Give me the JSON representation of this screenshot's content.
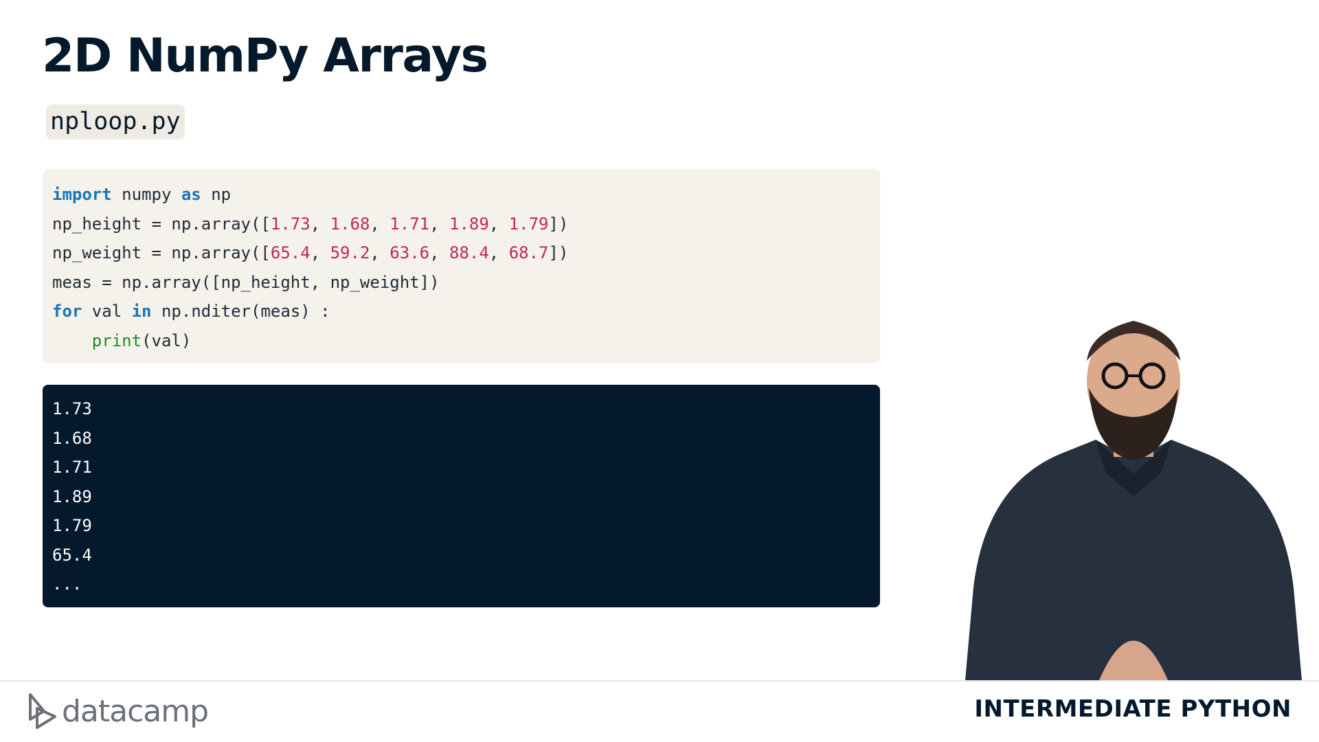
{
  "slide": {
    "title": "2D NumPy Arrays",
    "filename": "nploop.py"
  },
  "code": {
    "line1": {
      "kw1": "import",
      "t1": " numpy ",
      "kw2": "as",
      "t2": " np"
    },
    "line2": {
      "t1": "np_height = np.array([",
      "n1": "1.73",
      "s1": ", ",
      "n2": "1.68",
      "s2": ", ",
      "n3": "1.71",
      "s3": ", ",
      "n4": "1.89",
      "s4": ", ",
      "n5": "1.79",
      "t2": "])"
    },
    "line3": {
      "t1": "np_weight = np.array([",
      "n1": "65.4",
      "s1": ", ",
      "n2": "59.2",
      "s2": ", ",
      "n3": "63.6",
      "s3": ", ",
      "n4": "88.4",
      "s4": ", ",
      "n5": "68.7",
      "t2": "])"
    },
    "line4": {
      "t1": "meas = np.array([np_height, np_weight])"
    },
    "line5": {
      "kw1": "for",
      "t1": " val ",
      "kw2": "in",
      "t2": " np.nditer(meas) :"
    },
    "line6": {
      "indent": "    ",
      "fn": "print",
      "t1": "(val)"
    }
  },
  "output": [
    "1.73",
    "1.68",
    "1.71",
    "1.89",
    "1.79",
    "65.4",
    "..."
  ],
  "footer": {
    "brand": "datacamp",
    "course": "INTERMEDIATE PYTHON"
  },
  "colors": {
    "navy": "#05192d",
    "keyword": "#1976b8",
    "number": "#c2255c",
    "builtin": "#218a21",
    "code_bg": "#f5f2ec"
  },
  "icons": [
    "datacamp-logo-icon"
  ],
  "media": [
    "presenter-video"
  ]
}
